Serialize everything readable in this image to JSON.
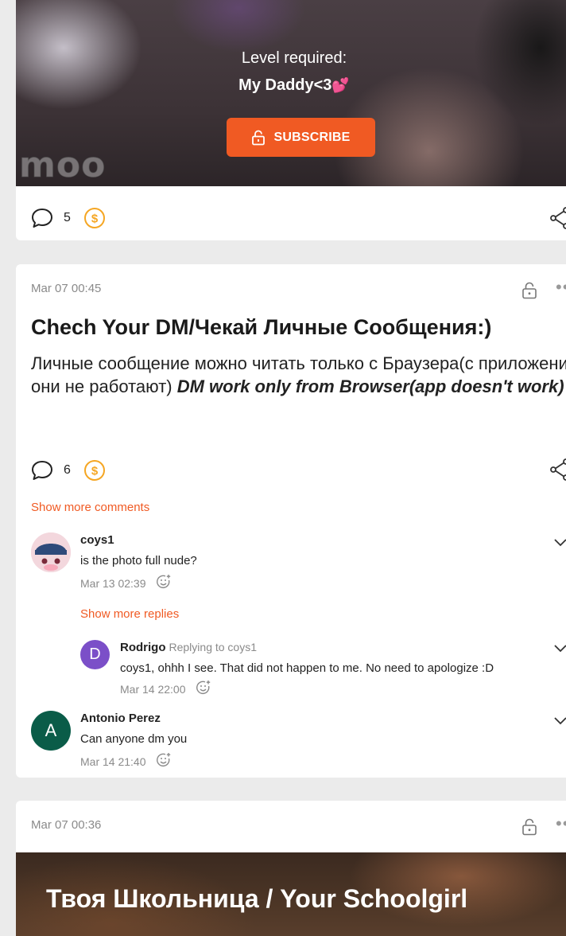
{
  "colors": {
    "accent": "#f05a23",
    "coin": "#f5a623",
    "rodrigo_avatar": "#7b4fc8",
    "antonio_avatar": "#0a5c48"
  },
  "post1": {
    "watermark": "moo",
    "level_label": "Level required:",
    "level_name": "My Daddy<3",
    "level_emoji": "💕",
    "subscribe_label": "SUBSCRIBE",
    "comment_count": "5"
  },
  "post2": {
    "date": "Mar 07 00:45",
    "title": "Chech Your DM/Чекай Личные Сообщения:)",
    "body_plain": "Личные сообщение можно читать только с Браузера(с приложения они не работают) ",
    "body_emphasis": "DM work only from Browser(app doesn't work)",
    "comment_count": "6",
    "show_more_comments": "Show more comments",
    "comments": [
      {
        "author": "coys1",
        "text": "is the photo full nude?",
        "time": "Mar 13 02:39"
      },
      {
        "author": "Antonio Perez",
        "avatar_letter": "A",
        "text": "Can anyone dm you",
        "time": "Mar 14 21:40"
      }
    ],
    "show_more_replies": "Show more replies",
    "reply": {
      "author": "Rodrigo",
      "avatar_letter": "D",
      "replying_to": "Replying to coys1",
      "text": "coys1, ohhh I see. That did not happen to me. No need to apologize :D",
      "time": "Mar 14 22:00"
    }
  },
  "post3": {
    "date": "Mar 07 00:36",
    "title": "Твоя Школьница / Your Schoolgirl"
  },
  "icons": [
    "comment-icon",
    "coin-icon",
    "share-icon",
    "lock-icon",
    "more-icon",
    "chevron-down-icon",
    "add-reaction-icon"
  ]
}
